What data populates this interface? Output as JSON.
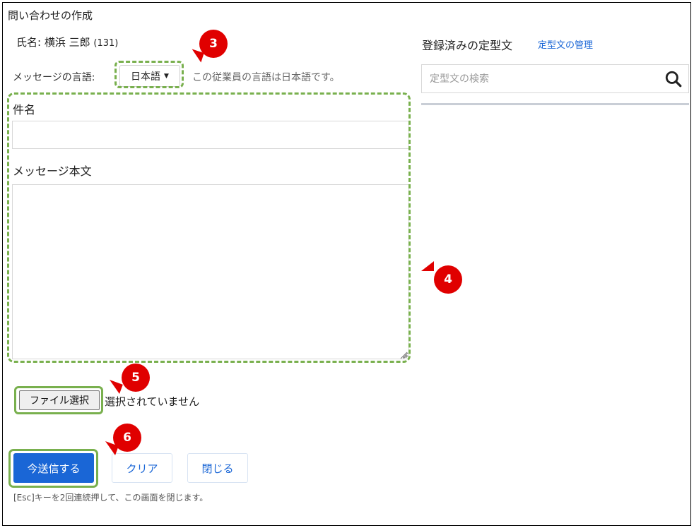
{
  "dialog": {
    "title": "問い合わせの作成",
    "employee_name": "氏名: 横浜 三郎",
    "employee_id": "(131)"
  },
  "language": {
    "label": "メッセージの言語:",
    "selected": "日本語",
    "note": "この従業員の言語は日本語です。"
  },
  "form": {
    "subject_label": "件名",
    "subject_value": "",
    "body_label": "メッセージ本文",
    "body_value": ""
  },
  "file": {
    "button_label": "ファイル選択",
    "status": "選択されていません"
  },
  "actions": {
    "send_label": "今送信する",
    "clear_label": "クリア",
    "close_label": "閉じる",
    "esc_note": "[Esc]キーを2回連続押して、この画面を閉じます。"
  },
  "templates": {
    "title": "登録済みの定型文",
    "manage_link": "定型文の管理",
    "search_placeholder": "定型文の検索"
  },
  "callouts": [
    "3",
    "4",
    "5",
    "6"
  ],
  "colors": {
    "primary": "#1a66d6",
    "highlight": "#79b04e",
    "callout": "#e00000"
  }
}
